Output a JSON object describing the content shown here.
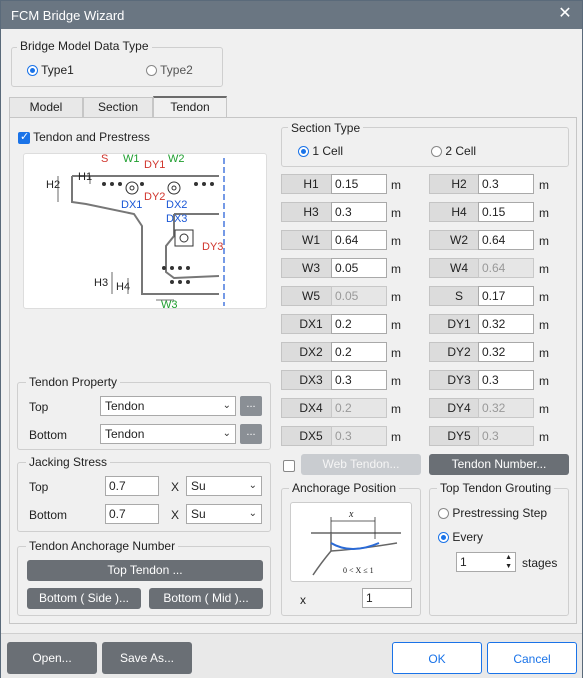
{
  "window": {
    "title": "FCM Bridge Wizard"
  },
  "model_type": {
    "legend": "Bridge Model Data Type",
    "type1": "Type1",
    "type2": "Type2"
  },
  "tabs": [
    "Model",
    "Section",
    "Tendon"
  ],
  "tendon_prestress": "Tendon and Prestress",
  "diagram_labels": [
    "S",
    "W1",
    "DY1",
    "W2",
    "H1",
    "H2",
    "DX1",
    "DY2",
    "DX2",
    "DX3",
    "DY3",
    "H3",
    "H4",
    "W3"
  ],
  "section_type": {
    "legend": "Section Type",
    "cell1": "1 Cell",
    "cell2": "2 Cell"
  },
  "params_left": [
    {
      "label": "H1",
      "value": "0.15",
      "unit": "m"
    },
    {
      "label": "H3",
      "value": "0.3",
      "unit": "m"
    },
    {
      "label": "W1",
      "value": "0.64",
      "unit": "m"
    },
    {
      "label": "W3",
      "value": "0.05",
      "unit": "m"
    },
    {
      "label": "W5",
      "value": "0.05",
      "unit": "m"
    },
    {
      "label": "DX1",
      "value": "0.2",
      "unit": "m"
    },
    {
      "label": "DX2",
      "value": "0.2",
      "unit": "m"
    },
    {
      "label": "DX3",
      "value": "0.3",
      "unit": "m"
    },
    {
      "label": "DX4",
      "value": "0.2",
      "unit": "m"
    },
    {
      "label": "DX5",
      "value": "0.3",
      "unit": "m"
    }
  ],
  "params_right": [
    {
      "label": "H2",
      "value": "0.3",
      "unit": "m"
    },
    {
      "label": "H4",
      "value": "0.15",
      "unit": "m"
    },
    {
      "label": "W2",
      "value": "0.64",
      "unit": "m"
    },
    {
      "label": "W4",
      "value": "0.64",
      "unit": "m"
    },
    {
      "label": "S",
      "value": "0.17",
      "unit": "m"
    },
    {
      "label": "DY1",
      "value": "0.32",
      "unit": "m"
    },
    {
      "label": "DY2",
      "value": "0.32",
      "unit": "m"
    },
    {
      "label": "DY3",
      "value": "0.3",
      "unit": "m"
    },
    {
      "label": "DY4",
      "value": "0.32",
      "unit": "m"
    },
    {
      "label": "DY5",
      "value": "0.3",
      "unit": "m"
    }
  ],
  "tendon_property": {
    "legend": "Tendon Property",
    "top_label": "Top",
    "top_value": "Tendon",
    "bottom_label": "Bottom",
    "bottom_value": "Tendon",
    "more": "..."
  },
  "jacking": {
    "legend": "Jacking Stress",
    "top_label": "Top",
    "top_value": "0.7",
    "bottom_label": "Bottom",
    "bottom_value": "0.7",
    "x": "X",
    "top_su": "Su",
    "bottom_su": "Su"
  },
  "anchorage_number": {
    "legend": "Tendon Anchorage Number",
    "top": "Top Tendon ...",
    "bottom_side": "Bottom ( Side )...",
    "bottom_mid": "Bottom ( Mid )..."
  },
  "web_tendon": "Web Tendon...",
  "tendon_number": "Tendon Number...",
  "anchorage_position": {
    "legend": "Anchorage Position",
    "fig_x": "x",
    "fig_range": "0 < X ≤ 1",
    "x_label": "x",
    "x_value": "1"
  },
  "grouting": {
    "legend": "Top Tendon Grouting",
    "prestress": "Prestressing Step",
    "every": "Every",
    "stages_value": "1",
    "stages": "stages"
  },
  "footer": {
    "open": "Open...",
    "save_as": "Save As...",
    "ok": "OK",
    "cancel": "Cancel"
  }
}
